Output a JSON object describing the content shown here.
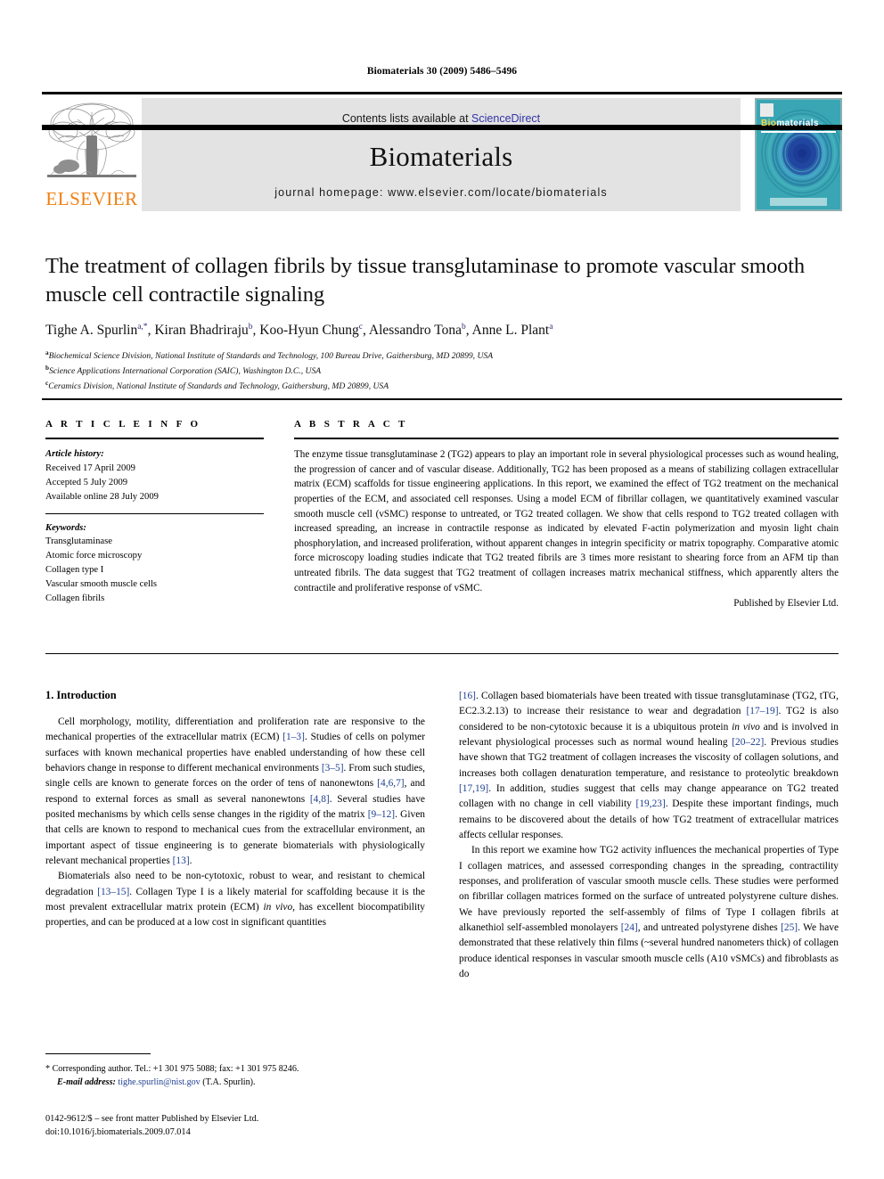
{
  "running_head": "Biomaterials 30 (2009) 5486–5496",
  "banner": {
    "contents_prefix": "Contents lists available at ",
    "sciencedirect": "ScienceDirect",
    "journal_name": "Biomaterials",
    "homepage": "journal homepage: www.elsevier.com/locate/biomaterials",
    "publisher_wordmark": "ELSEVIER",
    "publisher_color": "#f07f10",
    "link_color": "#3333aa",
    "banner_bg": "#e3e3e3",
    "cover": {
      "title_first": "Bio",
      "title_rest": "materials",
      "bg_color": "#2f9fae",
      "accent_color": "#f5d547"
    }
  },
  "title": "The treatment of collagen fibrils by tissue transglutaminase to promote vascular smooth muscle cell contractile signaling",
  "authors": [
    {
      "name": "Tighe A. Spurlin",
      "marks": "a,*"
    },
    {
      "name": "Kiran Bhadriraju",
      "marks": "b"
    },
    {
      "name": "Koo-Hyun Chung",
      "marks": "c"
    },
    {
      "name": "Alessandro Tona",
      "marks": "b"
    },
    {
      "name": "Anne L. Plant",
      "marks": "a"
    }
  ],
  "affiliations": [
    {
      "mark": "a",
      "text": "Biochemical Science Division, National Institute of Standards and Technology, 100 Bureau Drive, Gaithersburg, MD 20899, USA"
    },
    {
      "mark": "b",
      "text": "Science Applications International Corporation (SAIC), Washington D.C., USA"
    },
    {
      "mark": "c",
      "text": "Ceramics Division, National Institute of Standards and Technology, Gaithersburg, MD 20899, USA"
    }
  ],
  "article_info": {
    "heading": "A R T I C L E  I N F O",
    "history_label": "Article history:",
    "history": [
      "Received 17 April 2009",
      "Accepted 5 July 2009",
      "Available online 28 July 2009"
    ],
    "keywords_label": "Keywords:",
    "keywords": [
      "Transglutaminase",
      "Atomic force microscopy",
      "Collagen type I",
      "Vascular smooth muscle cells",
      "Collagen fibrils"
    ]
  },
  "abstract": {
    "heading": "A B S T R A C T",
    "text": "The enzyme tissue transglutaminase 2 (TG2) appears to play an important role in several physiological processes such as wound healing, the progression of cancer and of vascular disease. Additionally, TG2 has been proposed as a means of stabilizing collagen extracellular matrix (ECM) scaffolds for tissue engineering applications. In this report, we examined the effect of TG2 treatment on the mechanical properties of the ECM, and associated cell responses. Using a model ECM of fibrillar collagen, we quantitatively examined vascular smooth muscle cell (vSMC) response to untreated, or TG2 treated collagen. We show that cells respond to TG2 treated collagen with increased spreading, an increase in contractile response as indicated by elevated F-actin polymerization and myosin light chain phosphorylation, and increased proliferation, without apparent changes in integrin specificity or matrix topography. Comparative atomic force microscopy loading studies indicate that TG2 treated fibrils are 3 times more resistant to shearing force from an AFM tip than untreated fibrils. The data suggest that TG2 treatment of collagen increases matrix mechanical stiffness, which apparently alters the contractile and proliferative response of vSMC.",
    "signature": "Published by Elsevier Ltd."
  },
  "body": {
    "section_number_title": "1. Introduction",
    "left_paragraph_1": "Cell morphology, motility, differentiation and proliferation rate are responsive to the mechanical properties of the extracellular matrix (ECM) [1–3]. Studies of cells on polymer surfaces with known mechanical properties have enabled understanding of how these cell behaviors change in response to different mechanical environments [3–5]. From such studies, single cells are known to generate forces on the order of tens of nanonewtons [4,6,7], and respond to external forces as small as several nanonewtons [4,8]. Several studies have posited mechanisms by which cells sense changes in the rigidity of the matrix [9–12]. Given that cells are known to respond to mechanical cues from the extracellular environment, an important aspect of tissue engineering is to generate biomaterials with physiologically relevant mechanical properties [13].",
    "left_paragraph_2": "Biomaterials also need to be non-cytotoxic, robust to wear, and resistant to chemical degradation [13–15]. Collagen Type I is a likely material for scaffolding because it is the most prevalent extracellular matrix protein (ECM) in vivo, has excellent biocompatibility properties, and can be produced at a low cost in significant quantities",
    "right_paragraph_1": "[16]. Collagen based biomaterials have been treated with tissue transglutaminase (TG2, tTG, EC2.3.2.13) to increase their resistance to wear and degradation [17–19]. TG2 is also considered to be non-cytotoxic because it is a ubiquitous protein in vivo and is involved in relevant physiological processes such as normal wound healing [20–22]. Previous studies have shown that TG2 treatment of collagen increases the viscosity of collagen solutions, and increases both collagen denaturation temperature, and resistance to proteolytic breakdown [17,19]. In addition, studies suggest that cells may change appearance on TG2 treated collagen with no change in cell viability [19,23]. Despite these important findings, much remains to be discovered about the details of how TG2 treatment of extracellular matrices affects cellular responses.",
    "right_paragraph_2": "In this report we examine how TG2 activity influences the mechanical properties of Type I collagen matrices, and assessed corresponding changes in the spreading, contractility responses, and proliferation of vascular smooth muscle cells. These studies were performed on fibrillar collagen matrices formed on the surface of untreated polystyrene culture dishes. We have previously reported the self-assembly of films of Type I collagen fibrils at alkanethiol self-assembled monolayers [24], and untreated polystyrene dishes [25]. We have demonstrated that these relatively thin films (~several hundred nanometers thick) of collagen produce identical responses in vascular smooth muscle cells (A10 vSMCs) and fibroblasts as do"
  },
  "footnote": {
    "corresponding": "* Corresponding author. Tel.: +1 301 975 5088; fax: +1 301 975 8246.",
    "email_label": "E-mail address:",
    "email": "tighe.spurlin@nist.gov",
    "email_suffix": "(T.A. Spurlin).",
    "imprint_line1": "0142-9612/$ – see front matter Published by Elsevier Ltd.",
    "imprint_line2": "doi:10.1016/j.biomaterials.2009.07.014"
  }
}
